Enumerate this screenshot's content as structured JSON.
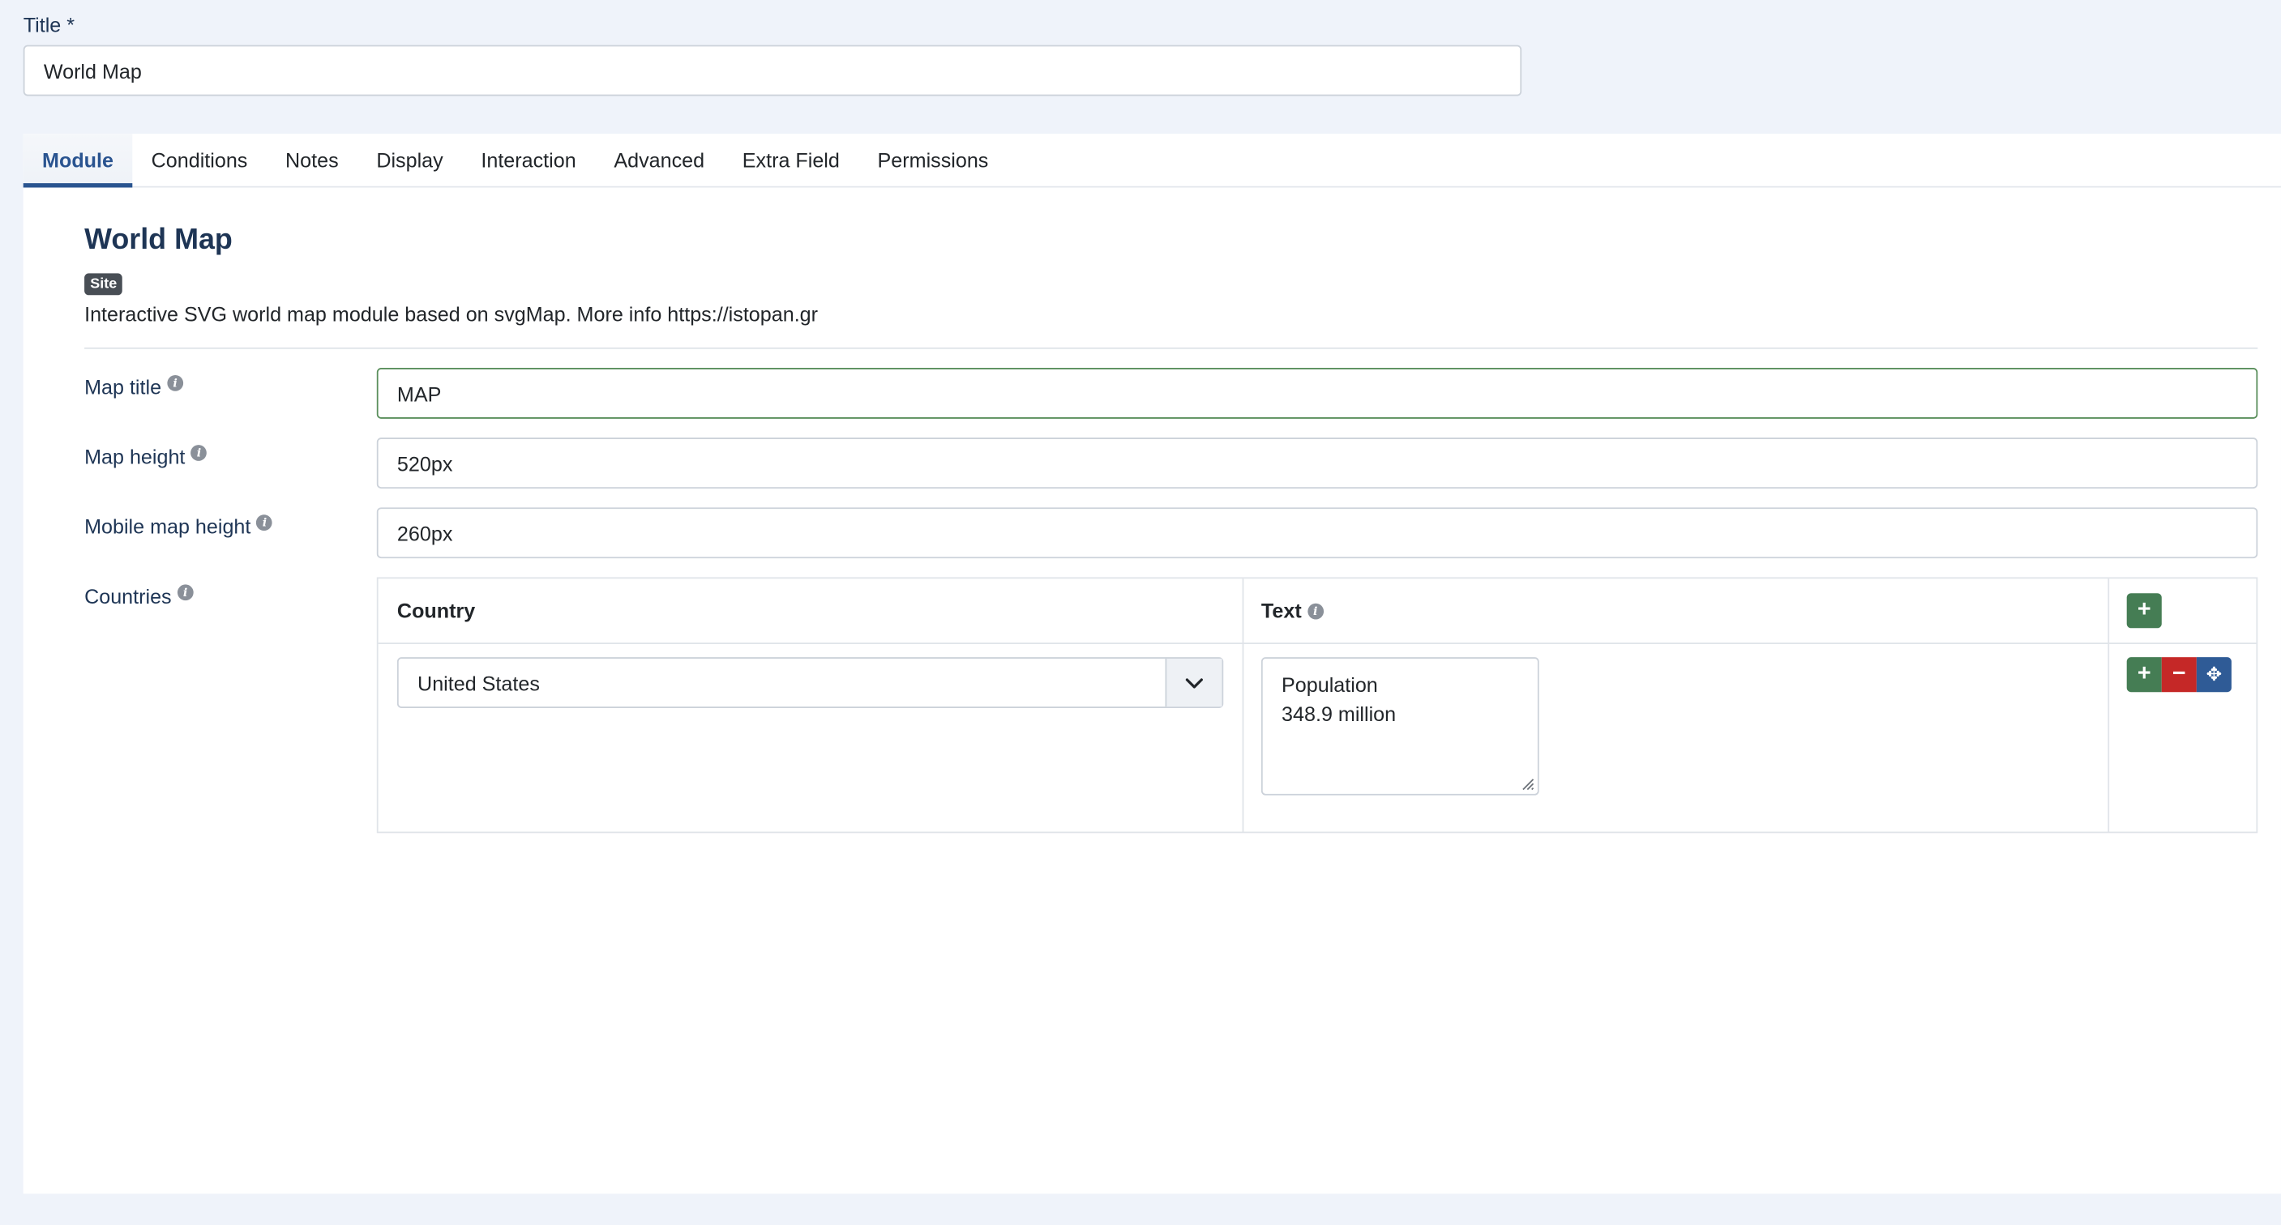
{
  "title_field": {
    "label": "Title *",
    "value": "World Map"
  },
  "tabs": [
    {
      "label": "Module",
      "active": true
    },
    {
      "label": "Conditions"
    },
    {
      "label": "Notes"
    },
    {
      "label": "Display"
    },
    {
      "label": "Interaction"
    },
    {
      "label": "Advanced"
    },
    {
      "label": "Extra Field"
    },
    {
      "label": "Permissions"
    }
  ],
  "module": {
    "title": "World Map",
    "badge": "Site",
    "description": "Interactive SVG world map module based on svgMap. More info https://istopan.gr"
  },
  "fields": {
    "map_title": {
      "label": "Map title",
      "value": "MAP"
    },
    "map_height": {
      "label": "Map height",
      "value": "520px"
    },
    "mobile_map_height": {
      "label": "Mobile map height",
      "value": "260px"
    },
    "countries": {
      "label": "Countries"
    }
  },
  "countries_table": {
    "headers": {
      "country": "Country",
      "text": "Text"
    },
    "rows": [
      {
        "country": "United States",
        "text": "Population\n348.9 million"
      }
    ],
    "buttons": {
      "add": "+",
      "remove": "−",
      "move": "✥"
    }
  },
  "colors": {
    "primary": "#2a5490",
    "success": "#457d54",
    "danger": "#c52827",
    "background": "#eff3fa"
  }
}
